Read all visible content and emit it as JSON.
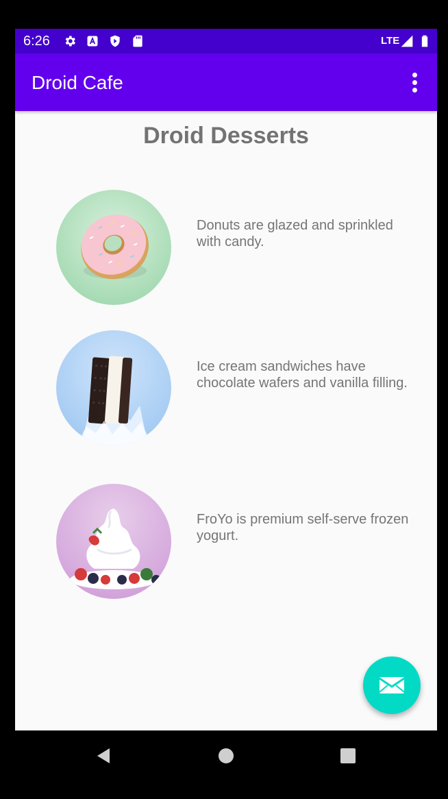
{
  "status_bar": {
    "time": "6:26",
    "network": "LTE",
    "icons": [
      "settings-icon",
      "a-icon",
      "play-protect-icon",
      "sd-card-icon",
      "signal-icon",
      "battery-icon"
    ]
  },
  "app_bar": {
    "title": "Droid Cafe",
    "menu_icon": "more-vert-icon"
  },
  "content": {
    "title": "Droid Desserts",
    "items": [
      {
        "name": "donut",
        "description": "Donuts are glazed and sprinkled with candy."
      },
      {
        "name": "ice-cream-sandwich",
        "description": "Ice cream sandwiches have chocolate wafers and vanilla filling."
      },
      {
        "name": "froyo",
        "description": "FroYo is premium self-serve frozen yogurt."
      }
    ]
  },
  "fab": {
    "icon": "mail-icon"
  },
  "nav_bar": {
    "icons": [
      "back-icon",
      "home-icon",
      "recents-icon"
    ]
  },
  "colors": {
    "status_bar": "#4400cc",
    "app_bar": "#6200ee",
    "fab": "#03dac5",
    "title_text": "#737373",
    "body_text": "#757575"
  }
}
